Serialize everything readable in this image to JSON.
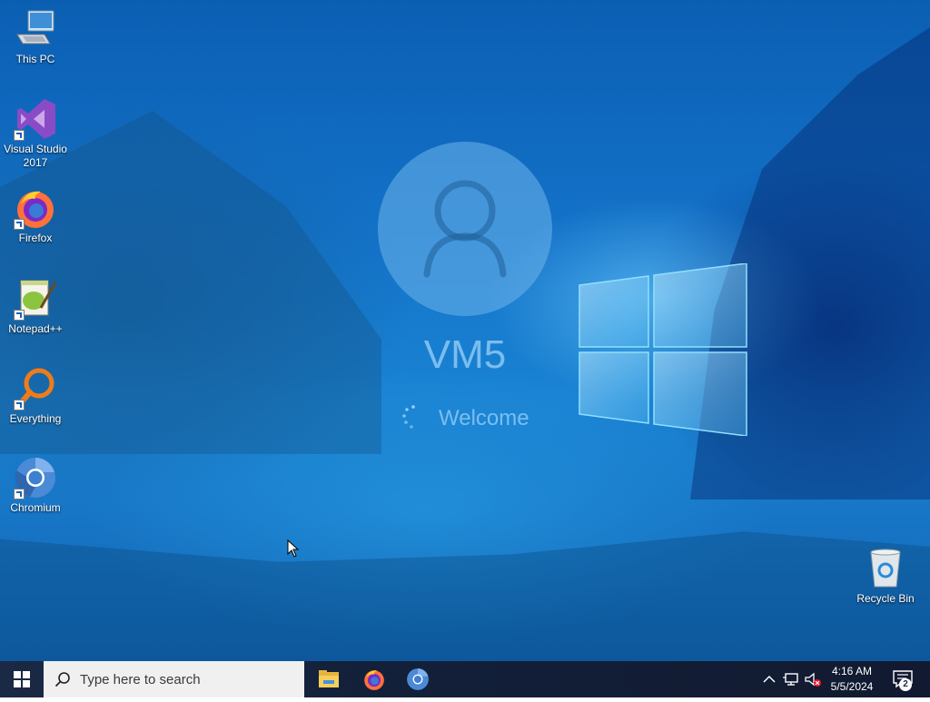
{
  "desktop": {
    "icons": [
      {
        "label": "This PC"
      },
      {
        "label": "Visual Studio\n2017"
      },
      {
        "label": "Firefox"
      },
      {
        "label": "Notepad++"
      },
      {
        "label": "Everything"
      },
      {
        "label": "Chromium"
      },
      {
        "label": "Recycle Bin"
      }
    ]
  },
  "login": {
    "username": "VM5",
    "status": "Welcome"
  },
  "taskbar": {
    "search_placeholder": "Type here to search",
    "pinned_apps": [
      "file-explorer-icon",
      "firefox-icon",
      "chromium-icon"
    ],
    "clock_time": "4:16 AM",
    "clock_date": "5/5/2024",
    "notification_count": "2"
  },
  "colors": {
    "taskbar": "#15213a",
    "desktop_blue": "#1372c8",
    "accent": "#5ab8f0"
  }
}
